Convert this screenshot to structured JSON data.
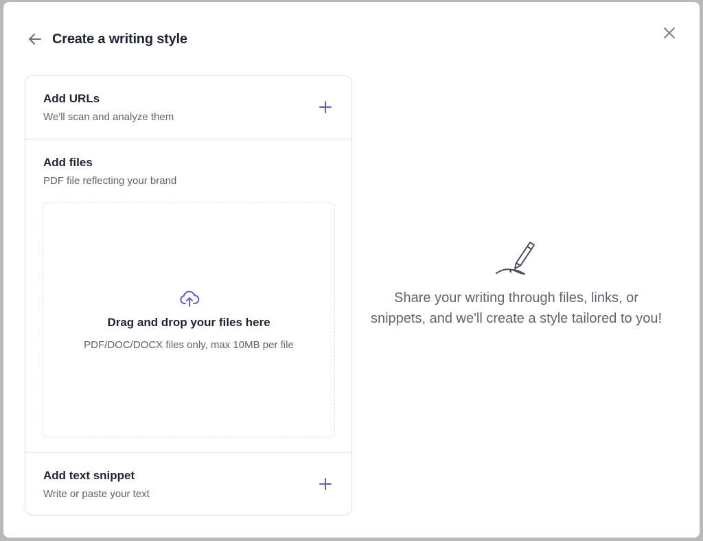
{
  "modal": {
    "title": "Create a writing style",
    "back_icon": "arrow-left-icon",
    "close_icon": "close-icon"
  },
  "sources": {
    "urls": {
      "title": "Add URLs",
      "subtitle": "We'll scan and analyze them",
      "action_icon": "plus-icon"
    },
    "files": {
      "title": "Add files",
      "subtitle": "PDF file reflecting your brand",
      "dropzone": {
        "icon": "cloud-upload-icon",
        "title": "Drag and drop your files here",
        "hint": "PDF/DOC/DOCX files only, max 10MB per file"
      }
    },
    "snippet": {
      "title": "Add text snippet",
      "subtitle": "Write or paste your text",
      "action_icon": "plus-icon"
    }
  },
  "empty_state": {
    "icon": "pen-icon",
    "message": "Share your writing through files, links, or snippets, and we'll create a style tailored to you!"
  },
  "colors": {
    "accent": "#6b56d6",
    "text_primary": "#1f2430",
    "text_secondary": "#5f636b",
    "border": "#dcdde0"
  }
}
